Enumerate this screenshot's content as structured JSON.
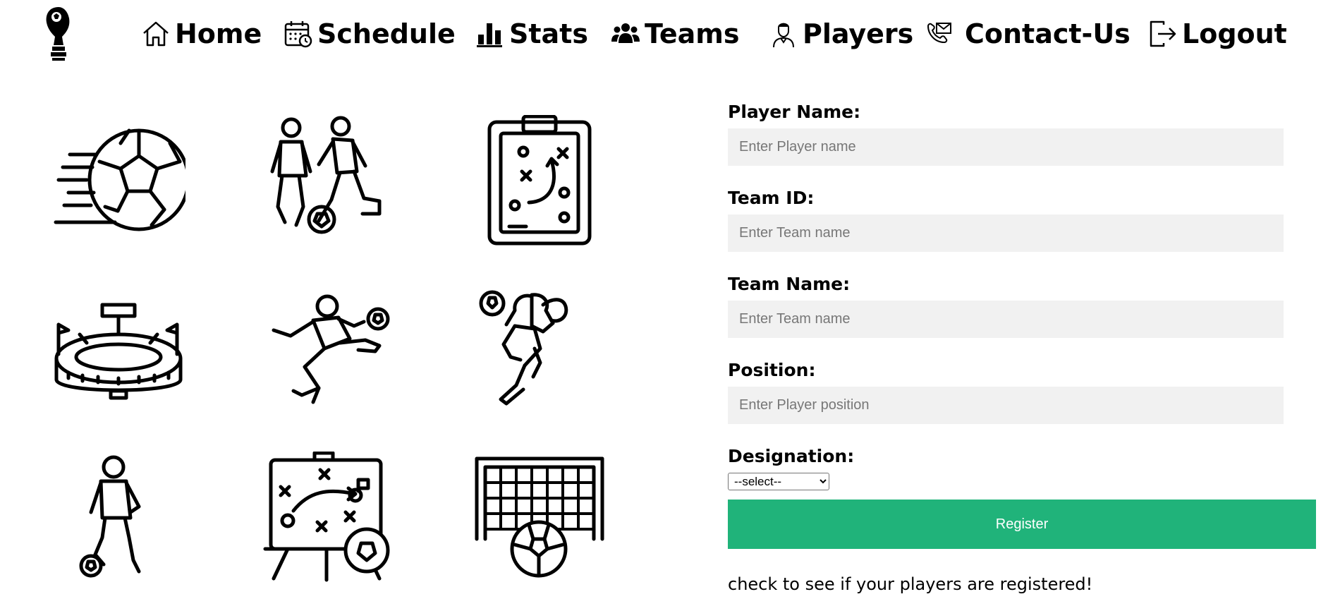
{
  "nav": {
    "home": "Home",
    "schedule": "Schedule",
    "stats": "Stats",
    "teams": "Teams",
    "players": "Players",
    "contact": "Contact-Us",
    "logout": "Logout"
  },
  "icons": [
    "soccer-ball-speed-icon",
    "two-players-dribbling-icon",
    "tactics-clipboard-icon",
    "stadium-icon",
    "player-kicking-ball-icon",
    "goalkeeper-diving-icon",
    "player-with-ball-icon",
    "tactics-board-icon",
    "goal-net-ball-icon"
  ],
  "form": {
    "player_name_label": "Player Name:",
    "player_name_placeholder": "Enter Player name",
    "team_id_label": "Team ID:",
    "team_id_placeholder": "Enter Team name",
    "team_name_label": "Team Name:",
    "team_name_placeholder": "Enter Team name",
    "position_label": "Position:",
    "position_placeholder": "Enter Player position",
    "designation_label": "Designation:",
    "designation_selected": "--select--",
    "register_label": "Register",
    "check_text": "check to see if your players are registered!"
  },
  "colors": {
    "register_button": "#20b37a",
    "input_background": "#f1f1f1"
  }
}
